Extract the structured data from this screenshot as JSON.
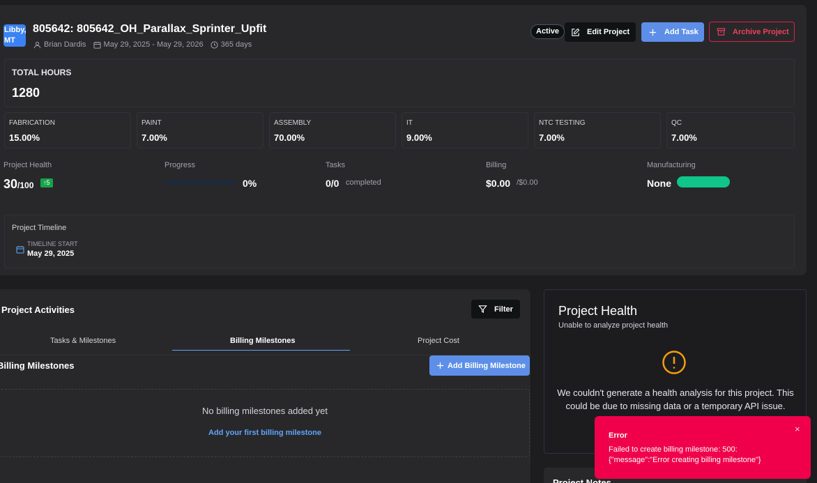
{
  "project": {
    "location_badge": "Libby, MT",
    "title": "805642: 805642_OH_Parallax_Sprinter_Upfit",
    "owner": "Brian Dardis",
    "date_range": "May 29, 2025 - May 29, 2026",
    "duration": "365 days",
    "status": "Active"
  },
  "header_actions": {
    "edit": "Edit Project",
    "add_task": "Add Task",
    "archive": "Archive Project"
  },
  "total_hours": {
    "label": "TOTAL HOURS",
    "value": "1280"
  },
  "departments": [
    {
      "label": "FABRICATION",
      "value": "15.00%"
    },
    {
      "label": "PAINT",
      "value": "7.00%"
    },
    {
      "label": "ASSEMBLY",
      "value": "70.00%"
    },
    {
      "label": "IT",
      "value": "9.00%"
    },
    {
      "label": "NTC TESTING",
      "value": "7.00%"
    },
    {
      "label": "QC",
      "value": "7.00%"
    }
  ],
  "stats": {
    "health": {
      "label": "Project Health",
      "value": "30",
      "max": "/100",
      "change": "↑5"
    },
    "progress": {
      "label": "Progress",
      "value": "0%",
      "fraction": 0
    },
    "tasks": {
      "label": "Tasks",
      "value": "0/0",
      "suffix": "completed"
    },
    "billing": {
      "label": "Billing",
      "value": "$0.00",
      "suffix": "/$0.00"
    },
    "manufacturing": {
      "label": "Manufacturing",
      "value": "None"
    }
  },
  "timeline": {
    "label": "Project Timeline",
    "start_label": "TIMELINE START",
    "start_value": "May 29, 2025"
  },
  "activities": {
    "title": "Project Activities",
    "filter": "Filter",
    "tabs": [
      "Tasks & Milestones",
      "Billing Milestones",
      "Project Cost"
    ],
    "active_tab": "Billing Milestones",
    "section_title": "Billing Milestones",
    "add_button": "Add Billing Milestone",
    "empty_text": "No billing milestones added yet",
    "empty_link": "Add your first billing milestone"
  },
  "health_panel": {
    "title": "Project Health",
    "subtitle": "Unable to analyze project health",
    "message": "We couldn't generate a health analysis for this project. This could be due to missing data or a temporary API issue."
  },
  "notes": {
    "title": "Project Notes"
  },
  "toast": {
    "title": "Error",
    "message": "Failed to create billing milestone: 500: {\"message\":\"Error creating billing milestone\"}",
    "close": "×"
  },
  "colors": {
    "accent": "#5d8fe8",
    "danger": "#f0004a",
    "success": "#10c48a",
    "warning": "#f59e0b"
  }
}
